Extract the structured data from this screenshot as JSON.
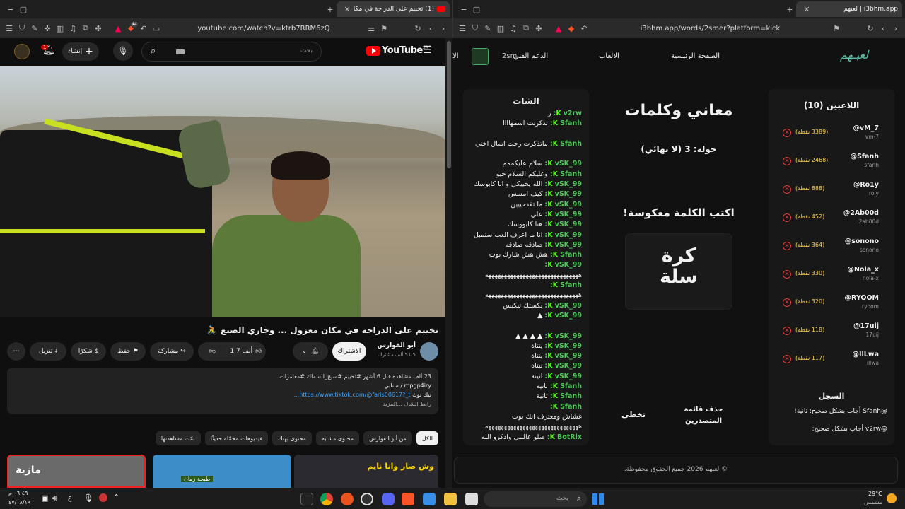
{
  "left_window": {
    "tab_title": "(1) تخييم على الدراجة في مكان ...",
    "url": "youtube.com/watch?v=ktrb7RRM6zQ",
    "brave_badge": "44"
  },
  "youtube": {
    "logo_text": "YouTube",
    "logo_region": "SA",
    "search_placeholder": "بحث",
    "create_label": "إنشاء",
    "notification_count": "1",
    "video_title": "تخييم على الدراجة في مكان معزول ... وجاري الضبع 🚴",
    "channel_name": "أبو الفوارس",
    "subscribers": "51.5 ألف مشترك",
    "subscribe_label": "الاشتراك",
    "likes": "1.7 ألف",
    "share_label": "مشاركة",
    "save_label": "حفظ",
    "thanks_label": "شكرًا",
    "download_label": "تنزيل",
    "description_stats": "23 ألف مشاهدة قبل 6 أشهر  #تخييم #سيح_السماك #مغامرات",
    "description_line2": "mpgp4iry / سنابي",
    "description_link": "https://www.tiktok.com/@faris00617?_t...",
    "description_link_prefix": "تيك توك",
    "description_more": "رابط الشال ...المزيد",
    "chips": [
      "الكل",
      "من أبو الفوارس",
      "محتوى مشابه",
      "محتوى بهتك",
      "فيديوهات محمّلة حديثًا",
      "تمّت مشاهدتها"
    ],
    "thumb1_text": "وش صار وانا نايم",
    "thumb2_text": "طبخة زمان",
    "thumb3_text": "مازية"
  },
  "right_window": {
    "tab_title": "لعبهم | i3bhm.app",
    "url": "i3bhm.app/words/2smer?platform=kick"
  },
  "site": {
    "logo": "لعبـهم",
    "nav_home": "الصفحة الرئيسية",
    "nav_games": "الالعاب",
    "nav_support": "الدعم الفني",
    "nav_user": "2sm",
    "nav_cut": "الا",
    "players_title": "اللاعبين (10)",
    "players": [
      {
        "name": "@vM_7",
        "handle": "vm-7",
        "points": "(3389 نقطة)"
      },
      {
        "name": "@Sfanh",
        "handle": "sfanh",
        "points": "(2468 نقطة)"
      },
      {
        "name": "@Ro1y",
        "handle": "roly",
        "points": "(888 نقطة)"
      },
      {
        "name": "@2Ab00d",
        "handle": "2ab00d",
        "points": "(452 نقطة)"
      },
      {
        "name": "@sonono",
        "handle": "sonono",
        "points": "(364 نقطة)"
      },
      {
        "name": "@Nola_x",
        "handle": "nola-x",
        "points": "(330 نقطة)"
      },
      {
        "name": "@RYOOM",
        "handle": "ryoom",
        "points": "(320 نقطة)"
      },
      {
        "name": "@17uij",
        "handle": "17uij",
        "points": "(118 نقطة)"
      },
      {
        "name": "@IlLwa",
        "handle": "illwa",
        "points": "(117 نقطة)"
      }
    ],
    "log_title": "السجل",
    "log": [
      "@Sfanh أجاب بشكل صحيح: ثانية!",
      "@v2rw أجاب بشكل صحيح:"
    ],
    "game_title": "معاني وكلمات",
    "round": "جولة: 3 (لا نهائي)",
    "prompt": "اكتب الكلمة معكوسة!",
    "word_line1": "كرة",
    "word_line2": "سلة",
    "btn_delete": "حذف قائمة المتصدرين",
    "btn_skip": "تخطي",
    "chat_title": "الشات",
    "chat": [
      {
        "user": "v2rw:",
        "msg": "ر"
      },
      {
        "user": "Sfanh:",
        "msg": "تذكرتت اسمهاااا"
      },
      {
        "user": "",
        "msg": ""
      },
      {
        "user": "Sfanh:",
        "msg": "ماتذكرت رحت اسال اختي"
      },
      {
        "user": "",
        "msg": ""
      },
      {
        "user": "vSK_99:",
        "msg": "سلام عليكممم"
      },
      {
        "user": "Sfanh:",
        "msg": "وعليكم السلام حيو"
      },
      {
        "user": "vSK_99:",
        "msg": "الله يحييكي و انا كابوسك"
      },
      {
        "user": "vSK_99:",
        "msg": "كيف امسس"
      },
      {
        "user": "vSK_99:",
        "msg": "ما تقدحييين"
      },
      {
        "user": "vSK_99:",
        "msg": "علي"
      },
      {
        "user": "vSK_99:",
        "msg": "هنا كابووسك"
      },
      {
        "user": "vSK_99:",
        "msg": "انا ما اعرف العب ستمبل"
      },
      {
        "user": "vSK_99:",
        "msg": "صادقه صادقه"
      },
      {
        "user": "Sfanh:",
        "msg": "هش هش شارك بوت"
      },
      {
        "user": "vSK_99:",
        "msg": ""
      },
      {
        "user": "",
        "msg": "ههههههههههههههههههههههههههههههه"
      },
      {
        "user": "Sfanh:",
        "msg": ""
      },
      {
        "user": "",
        "msg": "ههههههههههههههههههههههههههههههه"
      },
      {
        "user": "vSK_99:",
        "msg": "بكستك تبكيس"
      },
      {
        "user": "vSK_99:",
        "msg": "▲"
      },
      {
        "user": "",
        "msg": ""
      },
      {
        "user": "vSK_99:",
        "msg": "▲ ▲ ▲ ▲"
      },
      {
        "user": "vSK_99:",
        "msg": "يتناة"
      },
      {
        "user": "vSK_99:",
        "msg": "يتناة"
      },
      {
        "user": "vSK_99:",
        "msg": "نيتاة"
      },
      {
        "user": "vSK_99:",
        "msg": "اتينة"
      },
      {
        "user": "Sfanh:",
        "msg": "ثانيه"
      },
      {
        "user": "Sfanh:",
        "msg": "ثانية"
      },
      {
        "user": "Sfanh:",
        "msg": ""
      },
      {
        "user": "",
        "msg": "غشاش ومعترف انك بوت"
      },
      {
        "user": "",
        "msg": "ههههههههههههههههههههههههههههههه"
      },
      {
        "user": "BotRix:",
        "msg": "صلو عالنبي واذكرو الله"
      }
    ],
    "footer": "© لعبهم 2026 جميع الحقوق محفوظة."
  },
  "taskbar": {
    "time": "٠٦:٤٩ م",
    "date": "٤٧/٠٨/١٩",
    "lang": "ع",
    "search_placeholder": "بحث",
    "weather_temp": "29°C",
    "weather_desc": "مشمس"
  },
  "colors": {
    "accent_green": "#53fc18",
    "yt_red": "#ff0000",
    "remove_red": "#e03b3b",
    "gold_points": "#ffd24a"
  }
}
